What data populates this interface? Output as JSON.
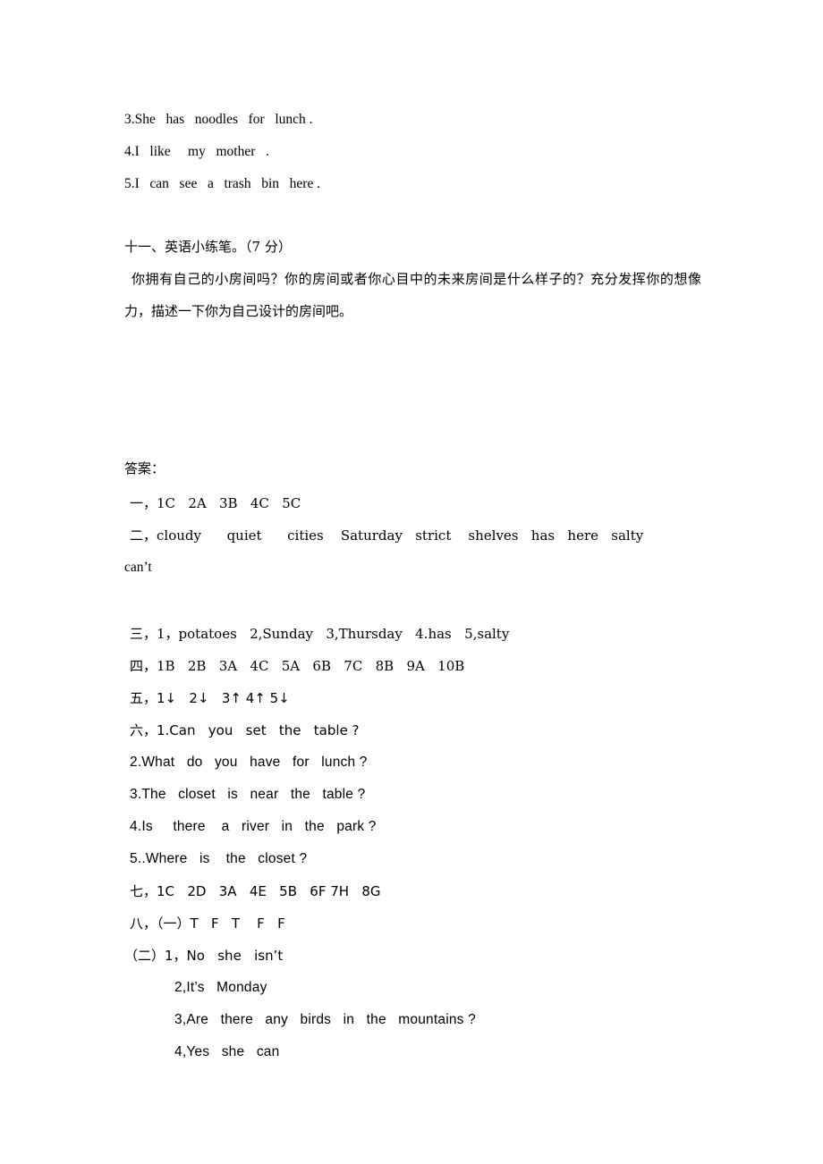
{
  "document": {
    "type": "english-exam-answer-sheet",
    "language": "zh-CN + en"
  },
  "top_exercises": {
    "lines": [
      "3.She   has   noodles   for   lunch .",
      "4.I   like     my   mother   .",
      "5.I   can   see   a   trash   bin   here ."
    ]
  },
  "section_eleven": {
    "heading": "十一、英语小练笔。（7 分）",
    "prompt": "你拥有自己的小房间吗？你的房间或者你心目中的未来房间是什么样子的？充分发挥你的想像力，描述一下你为自己设计的房间吧。"
  },
  "answers": {
    "heading": "答案：",
    "items": [
      {
        "label": "一，",
        "text": "1C   2A   3B   4C   5C",
        "font": "serif"
      },
      {
        "label": "二，",
        "text": "cloudy      quiet      cities    Saturday   strict    shelves   has   here   salty",
        "font": "serif"
      },
      {
        "label": "",
        "text": "can’t",
        "font": "serif"
      },
      {
        "label": "三，",
        "text": "1，potatoes   2,Sunday   3,Thursday   4.has   5,salty",
        "font": "serif"
      },
      {
        "label": "四，",
        "text": "1B   2B   3A   4C   5A   6B   7C   8B   9A   10B",
        "font": "serif"
      },
      {
        "label": "五，",
        "text": "1↓   2↓   3↑ 4↑ 5↓",
        "font": "sans"
      },
      {
        "label": "六，",
        "text": "1.Can   you   set   the   table ?",
        "font": "sans"
      },
      {
        "label": "",
        "text": "2.What   do   you   have   for   lunch ?",
        "font": "sans"
      },
      {
        "label": "",
        "text": "3.The   closet   is   near   the   table ?",
        "font": "sans"
      },
      {
        "label": "",
        "text": "4.Is     there    a   river   in   the   park ?",
        "font": "sans"
      },
      {
        "label": "",
        "text": "5..Where   is    the   closet ?",
        "font": "sans"
      },
      {
        "label": "七，",
        "text": "1C   2D   3A   4E   5B   6F 7H   8G",
        "font": "sans"
      },
      {
        "label": "八，",
        "text": "（一）T   F   T    F   F",
        "font": "sans"
      },
      {
        "label": "",
        "text": "（二）1，No   she   isn’t",
        "font": "sans"
      },
      {
        "label": "",
        "text": "2,It’s   Monday",
        "font": "sans",
        "indent": "sub"
      },
      {
        "label": "",
        "text": "3,Are   there   any   birds   in   the   mountains ?",
        "font": "sans",
        "indent": "sub"
      },
      {
        "label": "",
        "text": "4,Yes   she   can",
        "font": "sans",
        "indent": "sub"
      }
    ]
  },
  "lines_flat": {
    "l1": "3.She   has   noodles   for   lunch .",
    "l2": "4.I   like     my   mother   .",
    "l3": "5.I   can   see   a   trash   bin   here .",
    "heading11": "十一、英语小练笔。（7 分）",
    "prompt11": "你拥有自己的小房间吗？你的房间或者你心目中的未来房间是什么样子的？充分发挥你的想像力，描述一下你为自己设计的房间吧。",
    "ans_heading": "答案：",
    "a1": "一，1C   2A   3B   4C   5C",
    "a2": "二，cloudy      quiet      cities    Saturday   strict    shelves   has   here   salty",
    "a2b": "can’t",
    "a3": "三，1，potatoes   2,Sunday   3,Thursday   4.has   5,salty",
    "a4": "四，1B   2B   3A   4C   5A   6B   7C   8B   9A   10B",
    "a5": "五，1↓   2↓   3↑ 4↑ 5↓",
    "a6_1": "六，1.Can   you   set   the   table ?",
    "a6_2": "2.What   do   you   have   for   lunch ?",
    "a6_3": "3.The   closet   is   near   the   table ?",
    "a6_4": "4.Is     there    a   river   in   the   park ?",
    "a6_5": "5..Where   is    the   closet ?",
    "a7": "七，1C   2D   3A   4E   5B   6F 7H   8G",
    "a8_1": "八，（一）T   F   T    F   F",
    "a8_2": "（二）1，No   she   isn’t",
    "a8_3": "2,It’s   Monday",
    "a8_4": "3,Are   there   any   birds   in   the   mountains ?",
    "a8_5": "4,Yes   she   can"
  },
  "colors": {
    "page_background": "#ffffff",
    "text": "#000000"
  }
}
